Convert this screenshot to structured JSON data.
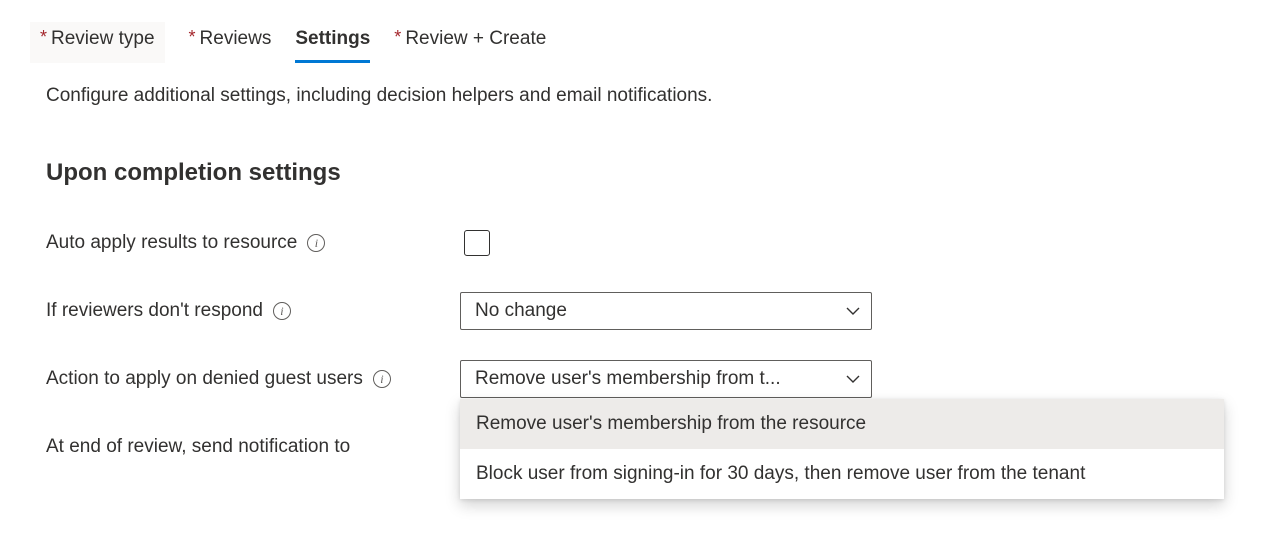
{
  "tabs": {
    "review_type": "Review type",
    "reviews": "Reviews",
    "settings": "Settings",
    "review_create": "Review + Create"
  },
  "description": "Configure additional settings, including decision helpers and email notifications.",
  "section_heading": "Upon completion settings",
  "form": {
    "auto_apply": {
      "label": "Auto apply results to resource",
      "checked": false
    },
    "if_no_response": {
      "label": "If reviewers don't respond",
      "value": "No change"
    },
    "action_denied_guest": {
      "label": "Action to apply on denied guest users",
      "value_truncated": "Remove user's membership from t...",
      "options": [
        "Remove user's membership from the resource",
        "Block user from signing-in for 30 days, then remove user from the tenant"
      ]
    },
    "end_review_notify": {
      "label": "At end of review, send notification to"
    }
  },
  "required_marker": "*"
}
